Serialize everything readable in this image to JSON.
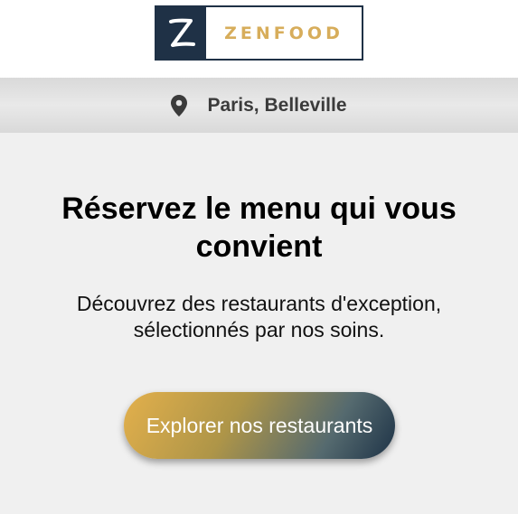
{
  "brand": {
    "mark": "Z",
    "name": "ZENFOOD"
  },
  "location": {
    "icon": "map-pin-icon",
    "label": "Paris, Belleville"
  },
  "hero": {
    "title": "Réservez le menu qui vous convient",
    "subtitle": "Découvrez des restaurants d'exception, sélectionnés par nos soins.",
    "cta_label": "Explorer nos restaurants"
  },
  "colors": {
    "brand_navy": "#1f3146",
    "brand_gold": "#d7ad5b",
    "hero_background": "#f0f0f0"
  }
}
